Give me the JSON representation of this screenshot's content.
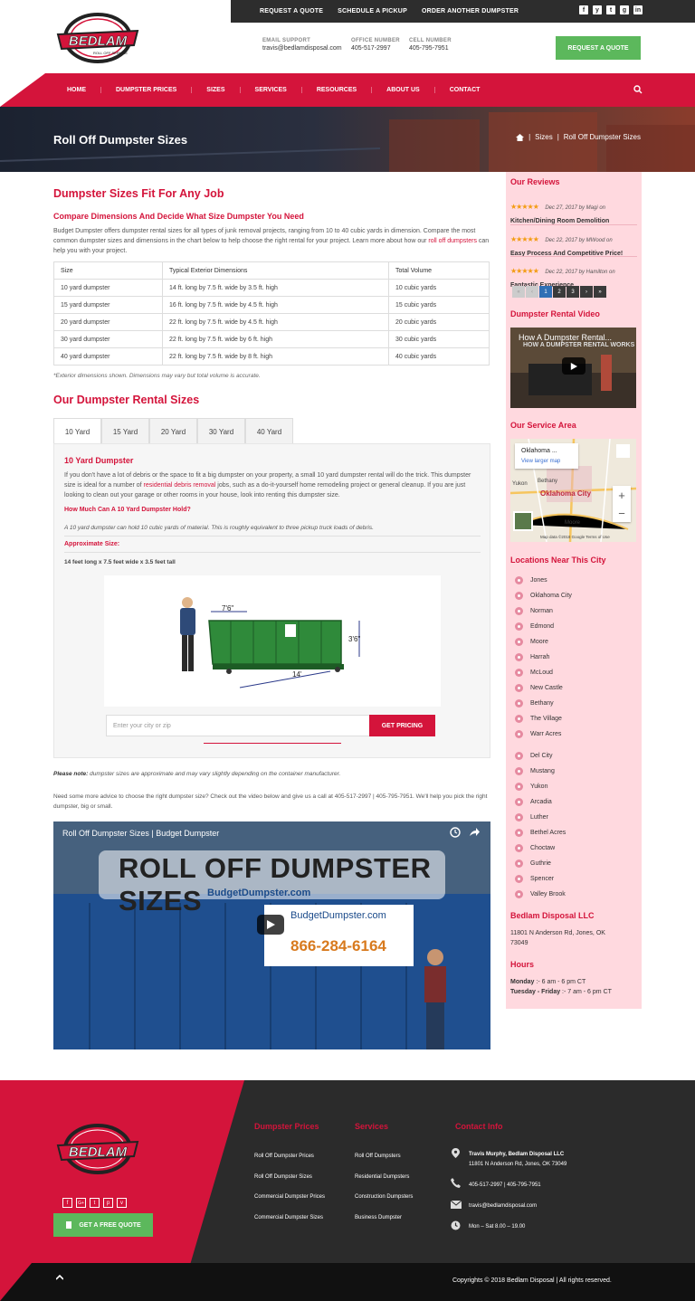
{
  "topbar": {
    "links": [
      "REQUEST A QUOTE",
      "SCHEDULE A PICKUP",
      "ORDER ANOTHER DUMPSTER"
    ],
    "social": [
      "f",
      "y",
      "t",
      "g",
      "in"
    ]
  },
  "logo": {
    "brand": "BEDLAM",
    "sub": "ROLL OFF SERVICE"
  },
  "contact": {
    "email_label": "EMAIL SUPPORT",
    "email": "travis@bedlamdisposal.com",
    "office_label": "OFFICE NUMBER",
    "office": "405-517-2997",
    "cell_label": "CELL NUMBER",
    "cell": "405-795-7951"
  },
  "header_button": "REQUEST A QUOTE",
  "nav": [
    "HOME",
    "DUMPSTER PRICES",
    "SIZES",
    "SERVICES",
    "RESOURCES",
    "ABOUT US",
    "CONTACT"
  ],
  "hero": {
    "title": "Roll Off Dumpster Sizes",
    "crumb_sep": "|",
    "crumb_1": "Sizes",
    "crumb_2": "Roll Off Dumpster Sizes"
  },
  "main": {
    "heading": "Dumpster Sizes Fit For Any Job",
    "subheading": "Compare Dimensions And Decide What Size Dumpster You Need",
    "intro_1": "Budget Dumpster offers dumpster rental sizes for all types of junk removal projects, ranging from 10 to 40 cubic yards in dimension. Compare the most common dumpster sizes and dimensions in the chart below to help choose the right rental for your project. Learn more about how our ",
    "intro_link": "roll off dumpsters",
    "intro_2": " can help you with your project.",
    "table_headers": [
      "Size",
      "Typical Exterior Dimensions",
      "Total Volume"
    ],
    "table_rows": [
      [
        "10 yard dumpster",
        "14 ft. long by 7.5 ft. wide by 3.5 ft. high",
        "10 cubic yards"
      ],
      [
        "15 yard dumpster",
        "16 ft. long by 7.5 ft. wide by 4.5 ft. high",
        "15 cubic yards"
      ],
      [
        "20 yard dumpster",
        "22 ft. long by 7.5 ft. wide by 4.5 ft. high",
        "20 cubic yards"
      ],
      [
        "30 yard dumpster",
        "22 ft. long by 7.5 ft. wide by 6 ft. high",
        "30 cubic yards"
      ],
      [
        "40 yard dumpster",
        "22 ft. long by 7.5 ft. wide by 8 ft. high",
        "40 cubic yards"
      ]
    ],
    "table_note": "*Exterior dimensions shown. Dimensions may vary but total volume is accurate.",
    "rental_heading": "Our Dumpster Rental Sizes",
    "tabs": [
      "10 Yard",
      "15 Yard",
      "20 Yard",
      "30 Yard",
      "40 Yard"
    ],
    "panel": {
      "title": "10 Yard Dumpster",
      "desc_1": "If you don't have a lot of debris or the space to fit a big dumpster on your property, a small 10 yard dumpster rental will do the trick. This dumpster size is ideal for a number of ",
      "desc_link": "residential debris removal",
      "desc_2": " jobs, such as a do-it-yourself home remodeling project or general cleanup. If you are just looking to clean out your garage or other rooms in your house, look into renting this dumpster size.",
      "hold_q": "How Much Can A 10 Yard Dumpster Hold?",
      "hold_a": "A 10 yard dumpster can hold 10 cubic yards of material. This is roughly equivalent to three pickup truck loads of debris.",
      "approx_label": "Approximate Size:",
      "approx_value": "14 feet long x 7.5 feet wide x 3.5 feet tall",
      "dim_w": "7'6\"",
      "dim_h": "3'6\"",
      "dim_l": "14'",
      "city_placeholder": "Enter your city or zip",
      "pricing_button": "GET PRICING"
    },
    "note_label": "Please note:",
    "note_text": " dumpster sizes are approximate and may vary slightly depending on the container manufacturer.",
    "advice": "Need some more advice to choose the right dumpster size? Check out the video below and give us a call at 405-517-2997 | 405-795-7951. We'll help you pick the right dumpster, big or small.",
    "video": {
      "title": "Roll Off Dumpster Sizes | Budget Dumpster",
      "banner": "ROLL OFF DUMPSTER SIZES",
      "banner_sub": "BudgetDumpster.com",
      "phone": "866-284-6164",
      "side_brand": "BudgetDumpster.com"
    }
  },
  "sidebar": {
    "reviews_heading": "Our Reviews",
    "reviews": [
      {
        "date": "Dec 27, 2017 by Magi on",
        "title": "Kitchen/Dining Room Demolition"
      },
      {
        "date": "Dec 22, 2017 by MWood on",
        "title": "Easy Process And Competitive Price!"
      },
      {
        "date": "Dec 22, 2017 by Hamilton on",
        "title": "Fantastic Experience"
      }
    ],
    "pager": [
      "«",
      "‹",
      "1",
      "2",
      "3",
      "›",
      "»"
    ],
    "video_heading": "Dumpster Rental Video",
    "video_title": "How A Dumpster Rental...",
    "video_banner": "HOW A DUMPSTER RENTAL WORKS",
    "area_heading": "Our Service Area",
    "map": {
      "place": "Oklahoma ...",
      "larger": "View larger map",
      "city": "Oklahoma City",
      "yukon": "Yukon",
      "bethany": "Bethany",
      "moore": "Moore",
      "footer": "Map data ©2018 Google   Terms of Use"
    },
    "locations_heading": "Locations Near This City",
    "locations_a": [
      "Jones",
      "Oklahoma City",
      "Norman",
      "Edmond",
      "Moore",
      "Harrah",
      "McLoud",
      "New Castle",
      "Bethany",
      "The Village",
      "Warr Acres"
    ],
    "locations_b": [
      "Del City",
      "Mustang",
      "Yukon",
      "Arcadia",
      "Luther",
      "Bethel Acres",
      "Choctaw",
      "Guthrie",
      "Spencer",
      "Valley Brook"
    ],
    "company": "Bedlam Disposal LLC",
    "address": "11801 N Anderson Rd, Jones, OK 73049",
    "hours_heading": "Hours",
    "hours_1_day": "Monday",
    "hours_1_time": " :- 6 am - 6 pm CT",
    "hours_2_day": "Tuesday - Friday",
    "hours_2_time": " :- 7 am - 6 pm CT"
  },
  "footer": {
    "social": [
      "f",
      "G+",
      "t",
      "p",
      "v"
    ],
    "free_quote": "GET A FREE QUOTE",
    "col1_heading": "Dumpster Prices",
    "col1": [
      "Roll Off Dumpster Prices",
      "Roll Off Dumpster Sizes",
      "Commercial Dumpster Prices",
      "Commercial Dumpster Sizes"
    ],
    "col2_heading": "Services",
    "col2": [
      "Roll Off Dumpsters",
      "Residential Dumpsters",
      "Construction Dumpsters",
      "Business Dumpster"
    ],
    "col3_heading": "Contact Info",
    "contact_name": "Travis Murphy, Bedlam Disposal LLC",
    "contact_addr": "11801 N Anderson Rd, Jones, OK 73049",
    "contact_phone": "405-517-2997 | 405-795-7951",
    "contact_email": "travis@bedlamdisposal.com",
    "contact_hours": "Mon – Sat 8.00 – 19.00",
    "copyright": "Copyrights © 2018 Bedlam Disposal | All rights reserved."
  },
  "colors": {
    "accent": "#d4143b",
    "green": "#5cb85c",
    "dark": "#2d2d2d",
    "sidebar_bg": "#ffd9df"
  }
}
